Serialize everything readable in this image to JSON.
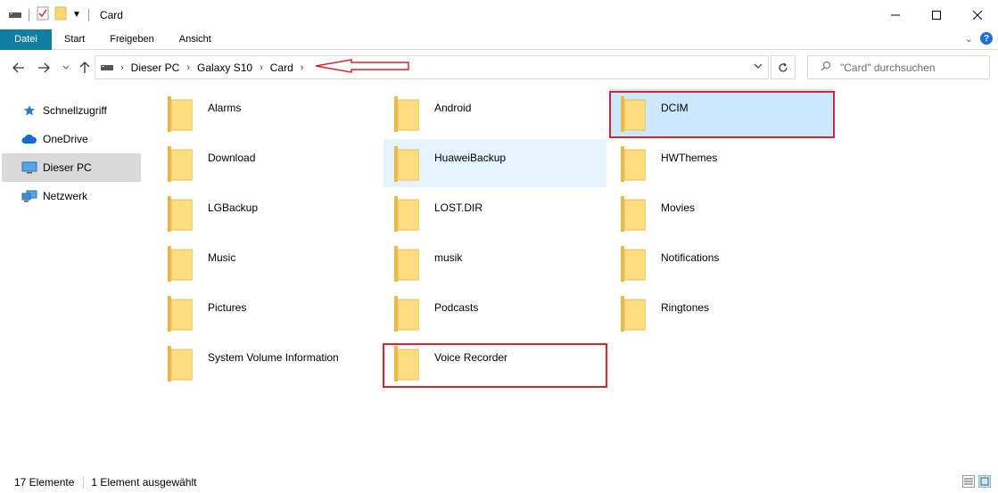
{
  "window": {
    "title": "Card"
  },
  "ribbon": {
    "file": "Datei",
    "tabs": [
      "Start",
      "Freigeben",
      "Ansicht"
    ]
  },
  "address": {
    "crumbs": [
      "Dieser PC",
      "Galaxy S10",
      "Card"
    ]
  },
  "search": {
    "placeholder": "\"Card\" durchsuchen"
  },
  "sidebar": {
    "items": [
      "Schnellzugriff",
      "OneDrive",
      "Dieser PC",
      "Netzwerk"
    ]
  },
  "folders": [
    "Alarms",
    "Android",
    "DCIM",
    "Download",
    "HuaweiBackup",
    "HWThemes",
    "LGBackup",
    "LOST.DIR",
    "Movies",
    "Music",
    "musik",
    "Notifications",
    "Pictures",
    "Podcasts",
    "Ringtones",
    "System Volume Information",
    "Voice Recorder"
  ],
  "status": {
    "count": "17 Elemente",
    "selected": "1 Element ausgewählt"
  },
  "colors": {
    "accent": "#0f7ea0",
    "selection": "#cce8ff",
    "annotation": "#d8262e"
  }
}
